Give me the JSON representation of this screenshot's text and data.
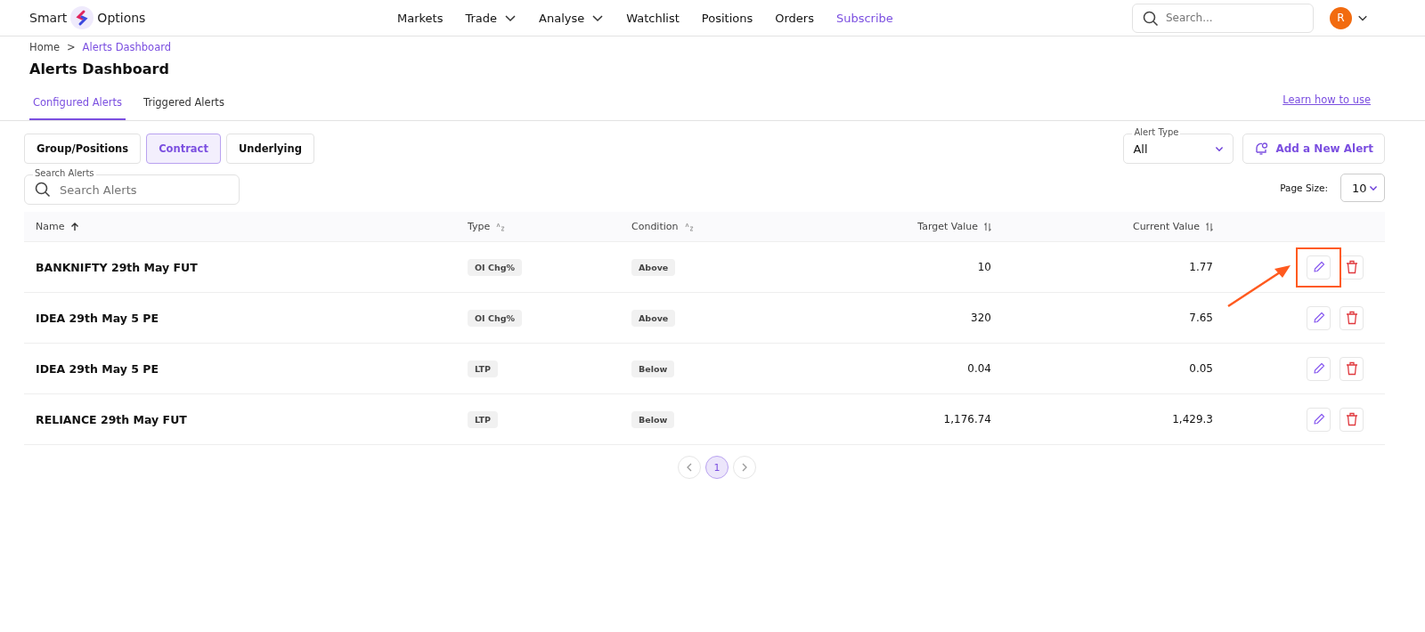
{
  "header": {
    "logo_left": "Smart",
    "logo_right": "Options",
    "nav": [
      {
        "label": "Markets",
        "dropdown": false,
        "selected": false
      },
      {
        "label": "Trade",
        "dropdown": true,
        "selected": false
      },
      {
        "label": "Analyse",
        "dropdown": true,
        "selected": false
      },
      {
        "label": "Watchlist",
        "dropdown": false,
        "selected": false
      },
      {
        "label": "Positions",
        "dropdown": false,
        "selected": false
      },
      {
        "label": "Orders",
        "dropdown": false,
        "selected": false
      },
      {
        "label": "Subscribe",
        "dropdown": false,
        "selected": true
      }
    ],
    "search": {
      "placeholder": "Search..."
    },
    "avatar": "R"
  },
  "breadcrumb": {
    "items": [
      "Home",
      "Alerts Dashboard"
    ],
    "separator": ">"
  },
  "title": "Alerts Dashboard",
  "tabs": [
    {
      "label": "Configured Alerts",
      "selected": true
    },
    {
      "label": "Triggered Alerts",
      "selected": false
    }
  ],
  "help_link": "Learn how to use",
  "filters": [
    {
      "label": "Group/Positions",
      "selected": false
    },
    {
      "label": "Contract",
      "selected": true
    },
    {
      "label": "Underlying",
      "selected": false
    }
  ],
  "alert_type": {
    "label": "Alert Type",
    "value": "All"
  },
  "add_button": "Add a New Alert",
  "search_alerts": {
    "label": "Search Alerts",
    "placeholder": "Search Alerts"
  },
  "page_size": {
    "label": "Page Size:",
    "value": "10"
  },
  "table": {
    "columns": [
      {
        "label": "Name",
        "kind": "ascending"
      },
      {
        "label": "Type",
        "kind": "alphabetic"
      },
      {
        "label": "Condition",
        "kind": "alphabetic"
      },
      {
        "label": "Target Value",
        "kind": "numeric"
      },
      {
        "label": "Current Value",
        "kind": "numeric"
      }
    ],
    "rows": [
      {
        "name": "BANKNIFTY 29th May FUT",
        "type": "OI Chg%",
        "condition": "Above",
        "target": "10",
        "current": "1.77",
        "highlighted": true
      },
      {
        "name": "IDEA 29th May 5 PE",
        "type": "OI Chg%",
        "condition": "Above",
        "target": "320",
        "current": "7.65",
        "highlighted": false
      },
      {
        "name": "IDEA 29th May 5 PE",
        "type": "LTP",
        "condition": "Below",
        "target": "0.04",
        "current": "0.05",
        "highlighted": false
      },
      {
        "name": "RELIANCE 29th May FUT",
        "type": "LTP",
        "condition": "Below",
        "target": "1,176.74",
        "current": "1,429.3",
        "highlighted": false
      }
    ]
  },
  "pagination": {
    "pages": [
      {
        "label": "1",
        "selected": true
      }
    ]
  }
}
